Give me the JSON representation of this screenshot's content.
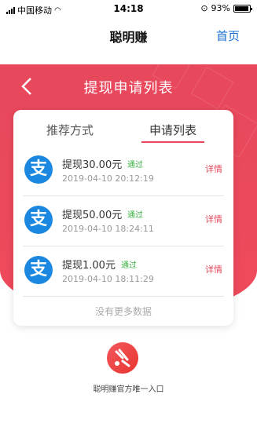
{
  "status_bar": {
    "carrier": "中国移动",
    "time": "14:18",
    "battery": "93%",
    "battery_level": 0.93
  },
  "nav": {
    "title": "聪明赚",
    "home": "首页"
  },
  "page": {
    "title": "提现申请列表"
  },
  "tabs": [
    {
      "label": "推荐方式"
    },
    {
      "label": "申请列表",
      "active": true
    }
  ],
  "records": [
    {
      "amount": "提现30.00元",
      "status": "通过",
      "time": "2019-04-10 20:12:19",
      "detail": "详情"
    },
    {
      "amount": "提现50.00元",
      "status": "通过",
      "time": "2019-04-10 18:24:11",
      "detail": "详情"
    },
    {
      "amount": "提现1.00元",
      "status": "通过",
      "time": "2019-04-10 18:11:29",
      "detail": "详情"
    }
  ],
  "no_more": "没有更多数据",
  "footer": {
    "official": "聪明赚官方唯一入口"
  },
  "colors": {
    "accent_red": "#e8485c",
    "alipay_blue": "#1a88e0",
    "status_green": "#3cb043",
    "link_blue": "#1a6fd6"
  }
}
